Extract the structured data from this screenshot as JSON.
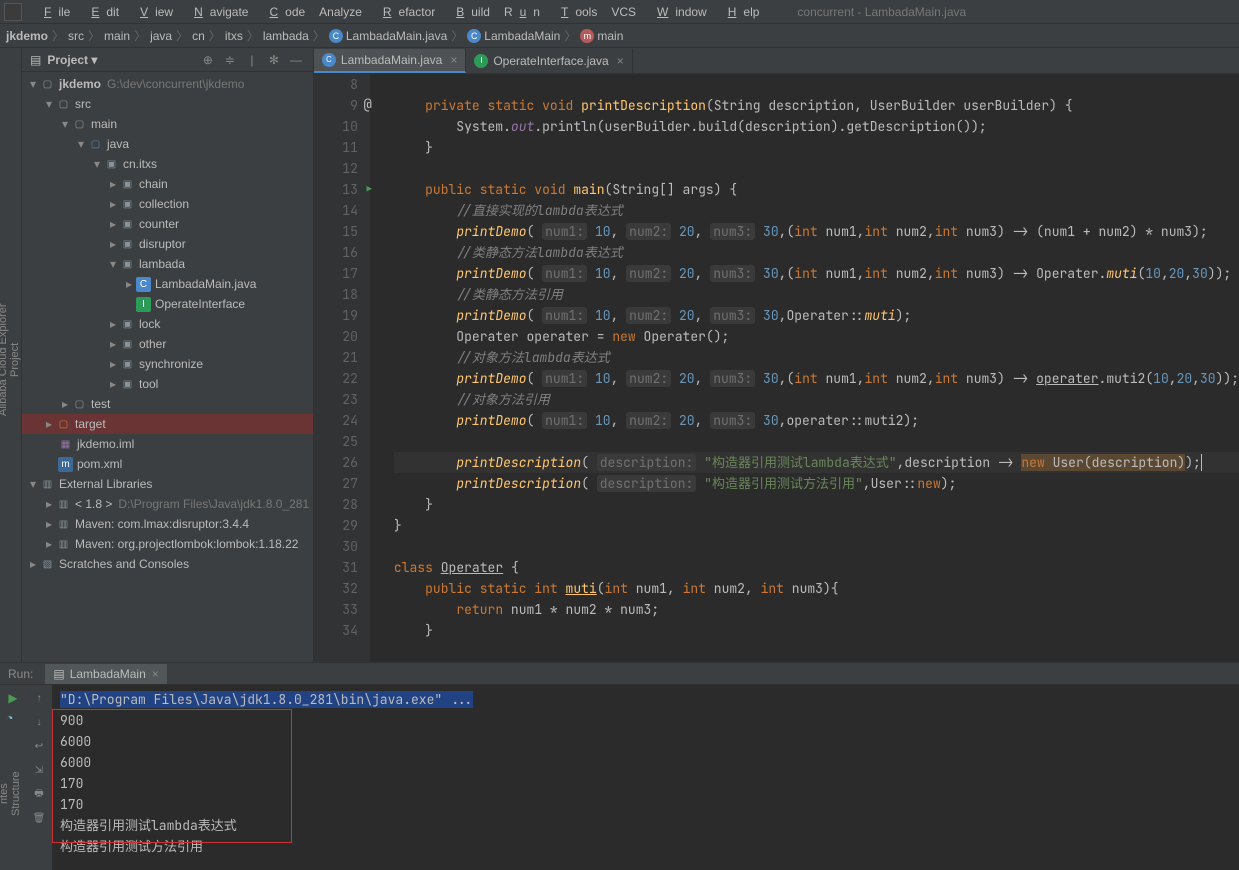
{
  "window": {
    "title": "concurrent - LambadaMain.java"
  },
  "menu": {
    "file": "File",
    "edit": "Edit",
    "view": "View",
    "navigate": "Navigate",
    "code": "Code",
    "analyze": "Analyze",
    "refactor": "Refactor",
    "build": "Build",
    "run": "Run",
    "tools": "Tools",
    "vcs": "VCS",
    "window": "Window",
    "help": "Help"
  },
  "breadcrumb": {
    "root": "jkdemo",
    "src": "src",
    "main": "main",
    "java": "java",
    "cn": "cn",
    "itxs": "itxs",
    "lambada": "lambada",
    "file": "LambadaMain.java",
    "cls": "LambadaMain",
    "method": "main"
  },
  "project_header": {
    "title": "Project"
  },
  "tree": {
    "root": "jkdemo",
    "root_path": "G:\\dev\\concurrent\\jkdemo",
    "src": "src",
    "main": "main",
    "java": "java",
    "pkg": "cn.itxs",
    "chain": "chain",
    "collection": "collection",
    "counter": "counter",
    "disruptor": "disruptor",
    "lambada": "lambada",
    "lambada_main": "LambadaMain.java",
    "op_int": "OperateInterface",
    "lock": "lock",
    "other": "other",
    "synchronize": "synchronize",
    "tool": "tool",
    "test": "test",
    "target": "target",
    "iml": "jkdemo.iml",
    "pom": "pom.xml",
    "ext_lib": "External Libraries",
    "jdk": "< 1.8 >",
    "jdk_path": "D:\\Program Files\\Java\\jdk1.8.0_281",
    "mvn1": "Maven: com.lmax:disruptor:3.4.4",
    "mvn2": "Maven: org.projectlombok:lombok:1.18.22",
    "scratches": "Scratches and Consoles"
  },
  "tabs": {
    "t1": "LambadaMain.java",
    "t2": "OperateInterface.java"
  },
  "code_lines": {
    "8": "",
    "13_main": "public static void main(String[] args) {"
  },
  "run": {
    "label": "Run:",
    "tab": "LambadaMain",
    "cmd": "\"D:\\Program Files\\Java\\jdk1.8.0_281\\bin\\java.exe\" ...",
    "out1": "900",
    "out2": "6000",
    "out3": "6000",
    "out4": "170",
    "out5": "170",
    "out6": "构造器引用测试lambda表达式",
    "out7": "构造器引用测试方法引用"
  },
  "left_tool": {
    "project": "Project",
    "cloud": "Alibaba Cloud Explorer",
    "structure": "Structure",
    "favorites": "rites"
  }
}
